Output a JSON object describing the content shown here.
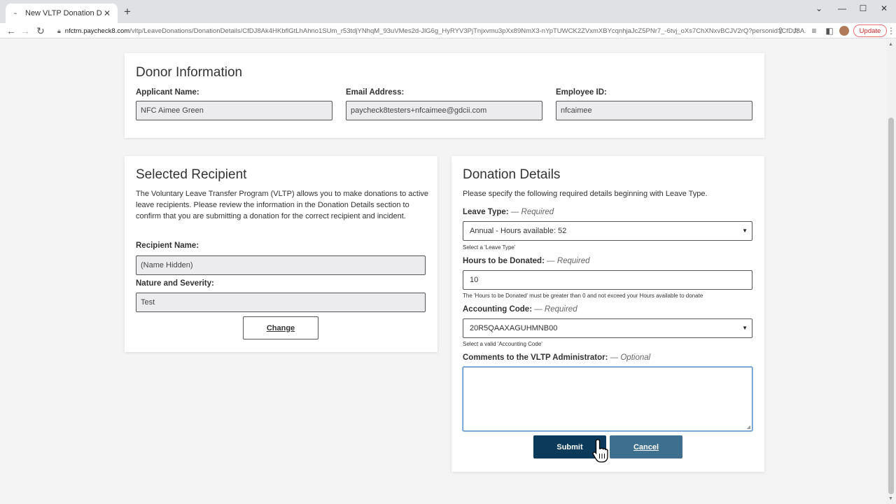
{
  "browser": {
    "tab_title": "New VLTP Donation Detail",
    "url_domain": "nfctrn.paycheck8.com",
    "url_path": "/vltp/LeaveDonations/DonationDetails/CfDJ8Ak4HKbflGtLhAhno1SUm_r53tdjYNhqM_93uVMes2d-JlG6g_HyRYV3PjTnjxvmu3pXx89NmX3-nYpTUWCK2ZVxmXBYcqnhjaJcZ5PNr7_-6tvj_oXs7ChXNxvBCJV2rQ?personid=CfDJ8A...",
    "update_label": "Update",
    "icons": [
      "back-icon",
      "forward-icon",
      "reload-icon",
      "lock-icon",
      "share-icon",
      "star-icon",
      "reading-list-icon",
      "side-panel-icon",
      "profile-avatar",
      "kebab-menu-icon"
    ]
  },
  "donor": {
    "heading": "Donor Information",
    "applicant_label": "Applicant Name:",
    "applicant_value": "NFC Aimee  Green",
    "email_label": "Email Address:",
    "email_value": "paycheck8testers+nfcaimee@gdcii.com",
    "employee_label": "Employee ID:",
    "employee_value": "nfcaimee"
  },
  "recipient": {
    "heading": "Selected Recipient",
    "description": "The Voluntary Leave Transfer Program (VLTP) allows you to make donations to active leave recipients. Please review the information in the Donation Details section to confirm that you are submitting a donation for the correct recipient and incident.",
    "name_label": "Recipient Name:",
    "name_value": "(Name Hidden)",
    "nature_label": "Nature and Severity:",
    "nature_value": "Test",
    "change_label": "Change"
  },
  "donation": {
    "heading": "Donation Details",
    "intro": "Please specify the following required details beginning with Leave Type.",
    "required_tag": "— Required",
    "optional_tag": "— Optional",
    "leave_type_label": "Leave Type:",
    "leave_type_value": "Annual - Hours available: 52",
    "leave_type_help": "Select a 'Leave Type'",
    "hours_label": "Hours to be Donated:",
    "hours_value": "10",
    "hours_help": "The 'Hours to be Donated' must be greater than 0 and not exceed your Hours available to donate",
    "accounting_label": "Accounting Code:",
    "accounting_value": "20R5QAAXAGUHMNB00",
    "accounting_help": "Select a valid 'Accounting Code'",
    "comments_label": "Comments to the VLTP Administrator:",
    "comments_value": "",
    "submit_label": "Submit",
    "cancel_label": "Cancel"
  },
  "colors": {
    "submit": "#0c3a5a",
    "cancel": "#3f6f8f",
    "update_border": "#e57373"
  }
}
